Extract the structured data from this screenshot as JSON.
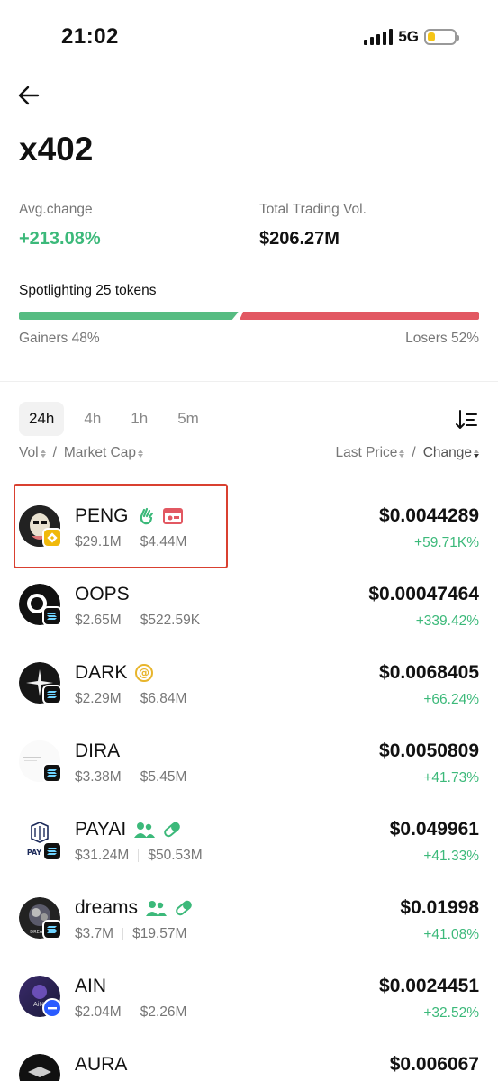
{
  "status_bar": {
    "time": "21:02",
    "network": "5G"
  },
  "header": {
    "title": "x402"
  },
  "stats": {
    "avg_change_label": "Avg.change",
    "avg_change_value": "+213.08%",
    "volume_label": "Total Trading Vol.",
    "volume_value": "$206.27M"
  },
  "spotlight": {
    "label": "Spotlighting 25 tokens",
    "gainers_label": "Gainers 48%",
    "losers_label": "Losers 52%",
    "gainers_fraction": 0.48
  },
  "tabs": [
    {
      "label": "24h",
      "active": true
    },
    {
      "label": "4h",
      "active": false
    },
    {
      "label": "1h",
      "active": false
    },
    {
      "label": "5m",
      "active": false
    }
  ],
  "columns": {
    "vol": "Vol",
    "slash1": "/",
    "market_cap": "Market Cap",
    "last_price": "Last Price",
    "slash2": "/",
    "change": "Change"
  },
  "tokens": [
    {
      "name": "PENG",
      "vol": "$29.1M",
      "mcap": "$4.44M",
      "price": "$0.0044289",
      "change": "+59.71K%",
      "badges": [
        "wave-hand-icon",
        "news-icon"
      ],
      "chain": "bnb"
    },
    {
      "name": "OOPS",
      "vol": "$2.65M",
      "mcap": "$522.59K",
      "price": "$0.00047464",
      "change": "+339.42%",
      "badges": [],
      "chain": "solana"
    },
    {
      "name": "DARK",
      "vol": "$2.29M",
      "mcap": "$6.84M",
      "price": "$0.0068405",
      "change": "+66.24%",
      "badges": [
        "at-icon"
      ],
      "chain": "solana"
    },
    {
      "name": "DIRA",
      "vol": "$3.38M",
      "mcap": "$5.45M",
      "price": "$0.0050809",
      "change": "+41.73%",
      "badges": [],
      "chain": "solana"
    },
    {
      "name": "PAYAI",
      "vol": "$31.24M",
      "mcap": "$50.53M",
      "price": "$0.049961",
      "change": "+41.33%",
      "badges": [
        "users-icon",
        "pill-icon"
      ],
      "chain": "solana"
    },
    {
      "name": "dreams",
      "vol": "$3.7M",
      "mcap": "$19.57M",
      "price": "$0.01998",
      "change": "+41.08%",
      "badges": [
        "users-icon",
        "pill-icon"
      ],
      "chain": "solana"
    },
    {
      "name": "AIN",
      "vol": "$2.04M",
      "mcap": "$2.26M",
      "price": "$0.0024451",
      "change": "+32.52%",
      "badges": [],
      "chain": "base"
    },
    {
      "name": "AURA",
      "vol": "",
      "mcap": "",
      "price": "$0.006067",
      "change": "",
      "badges": [],
      "chain": "solana"
    }
  ],
  "avatar_labels": {
    "payai": "PAY",
    "dreams": "DREAMS",
    "ain": "AiNe"
  },
  "colors": {
    "green": "#3cb97a",
    "red": "#e25862",
    "highlight": "#d94030"
  }
}
